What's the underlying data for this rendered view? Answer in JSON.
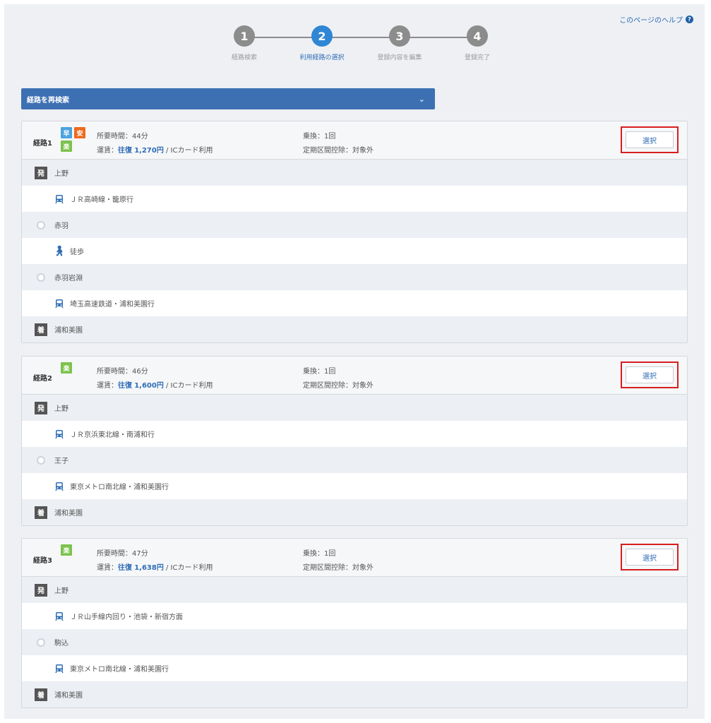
{
  "header": {
    "help_label": "このページのヘルプ",
    "help_icon": "question-circle-icon"
  },
  "stepper": {
    "steps": [
      {
        "number": "1",
        "label": "経路検索"
      },
      {
        "number": "2",
        "label": "利用経路の選択"
      },
      {
        "number": "3",
        "label": "登録内容を編集"
      },
      {
        "number": "4",
        "label": "登録完了"
      }
    ],
    "active_step": 2
  },
  "research": {
    "label": "経路を再検索",
    "icon": "chevron-down-icon"
  },
  "labels": {
    "duration": "所要時間：",
    "fare": "運賃：",
    "fare_direction": "往復",
    "fare_suffix": " / ICカード利用",
    "transfers": "乗換：",
    "commuter": "定期区間控除：",
    "select": "選択"
  },
  "colors": {
    "accent": "#2f86d4",
    "header_bar": "#3d70b3",
    "badge_fast": "#4aa3df",
    "badge_cheap": "#ee6a1e",
    "badge_easy": "#7cc24d",
    "highlight": "#d81e1e"
  },
  "routes": [
    {
      "name": "経路1",
      "badges": [
        "早",
        "安",
        "楽"
      ],
      "duration": "44分",
      "fare": "1,270円",
      "transfers": "1回",
      "commuter": "対象外",
      "rows": [
        {
          "kind": "dep",
          "mark": "発",
          "text": "上野"
        },
        {
          "kind": "train",
          "text": "ＪＲ高崎線・籠原行"
        },
        {
          "kind": "stop",
          "text": "赤羽"
        },
        {
          "kind": "walk",
          "text": "徒歩"
        },
        {
          "kind": "stop",
          "text": "赤羽岩淵"
        },
        {
          "kind": "train",
          "text": "埼玉高速鉄道・浦和美園行"
        },
        {
          "kind": "arr",
          "mark": "着",
          "text": "浦和美園"
        }
      ]
    },
    {
      "name": "経路2",
      "badges": [
        "楽"
      ],
      "duration": "46分",
      "fare": "1,600円",
      "transfers": "1回",
      "commuter": "対象外",
      "rows": [
        {
          "kind": "dep",
          "mark": "発",
          "text": "上野"
        },
        {
          "kind": "train",
          "text": "ＪＲ京浜東北線・南浦和行"
        },
        {
          "kind": "stop",
          "text": "王子"
        },
        {
          "kind": "train",
          "text": "東京メトロ南北線・浦和美園行"
        },
        {
          "kind": "arr",
          "mark": "着",
          "text": "浦和美園"
        }
      ]
    },
    {
      "name": "経路3",
      "badges": [
        "楽"
      ],
      "duration": "47分",
      "fare": "1,638円",
      "transfers": "1回",
      "commuter": "対象外",
      "rows": [
        {
          "kind": "dep",
          "mark": "発",
          "text": "上野"
        },
        {
          "kind": "train",
          "text": "ＪＲ山手線内回り・池袋・新宿方面"
        },
        {
          "kind": "stop",
          "text": "駒込"
        },
        {
          "kind": "train",
          "text": "東京メトロ南北線・浦和美園行"
        },
        {
          "kind": "arr",
          "mark": "着",
          "text": "浦和美園"
        }
      ]
    }
  ]
}
